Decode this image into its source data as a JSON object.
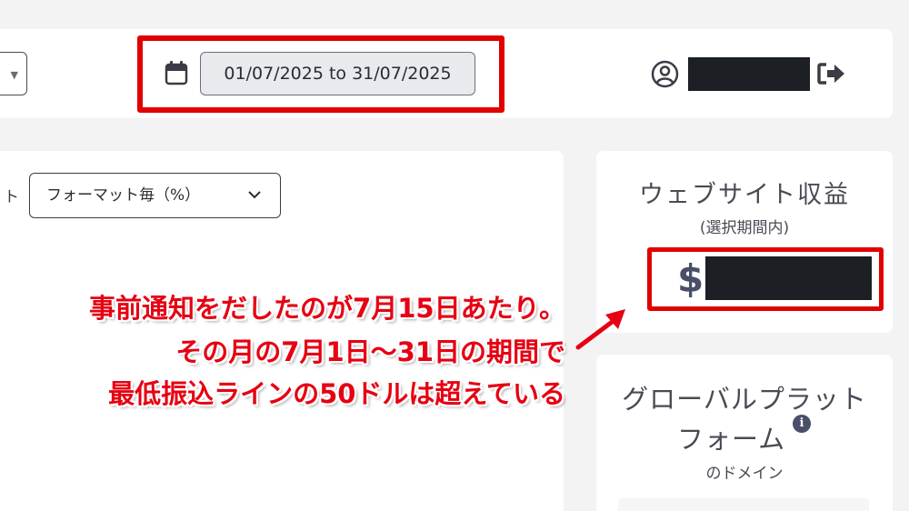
{
  "colors": {
    "accent_red": "#e00000",
    "annotation_red": "#e60012",
    "text": "#3c3c46",
    "mask": "#1c1f24"
  },
  "topbar": {
    "date_range": "01/07/2025 to 31/07/2025",
    "icons": [
      "calendar-icon",
      "user-circle-icon",
      "logout-icon",
      "caret-down-icon"
    ]
  },
  "filters": {
    "label_fragment": "ト",
    "format_select_value": "フォーマット毎（%）"
  },
  "revenue": {
    "title": "ウェブサイト収益",
    "subtitle": "(選択期間内)",
    "currency": "$"
  },
  "global_platform": {
    "title_line1": "グローバルプラット",
    "title_line2": "フォーム",
    "info_label": "i",
    "subtitle": "のドメイン"
  },
  "annotation": {
    "line1": "事前通知をだしたのが7月15日あたり。",
    "line2": "その月の7月1日～31日の期間で",
    "line3": "最低振込ラインの50ドルは超えている"
  }
}
